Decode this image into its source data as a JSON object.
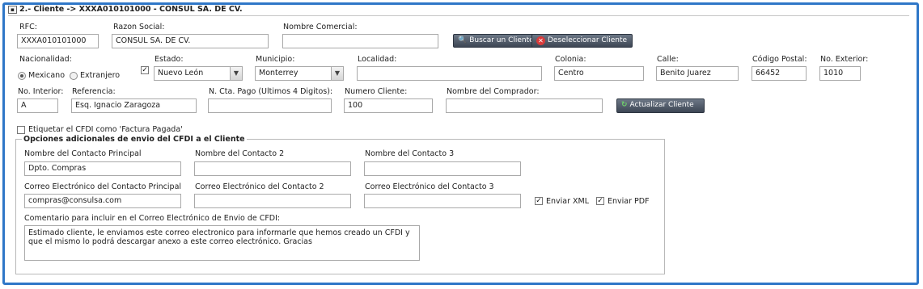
{
  "section": {
    "title": "2.- Cliente -> XXXA010101000 - CONSUL SA. DE CV.",
    "toggle_symbol": "▪"
  },
  "labels": {
    "rfc": "RFC:",
    "razon_social": "Razon Social:",
    "nombre_comercial": "Nombre Comercial:",
    "nacionalidad": "Nacionalidad:",
    "estado": "Estado:",
    "municipio": "Municipio:",
    "localidad": "Localidad:",
    "colonia": "Colonia:",
    "calle": "Calle:",
    "codigo_postal": "Código Postal:",
    "no_exterior": "No. Exterior:",
    "no_interior": "No. Interior:",
    "referencia": "Referencia:",
    "cta_pago": "N. Cta. Pago (Ultimos 4 Digitos):",
    "numero_cliente": "Numero Cliente:",
    "nombre_comprador": "Nombre del Comprador:"
  },
  "values": {
    "rfc": "XXXA010101000",
    "razon_social": "CONSUL SA. DE CV.",
    "nombre_comercial": "",
    "estado": "Nuevo León",
    "municipio": "Monterrey",
    "localidad": "",
    "colonia": "Centro",
    "calle": "Benito Juarez",
    "codigo_postal": "66452",
    "no_exterior": "1010",
    "no_interior": "A",
    "referencia": "Esq. Ignacio Zaragoza",
    "cta_pago": "",
    "numero_cliente": "100",
    "nombre_comprador": ""
  },
  "nacionalidad": {
    "options": [
      "Mexicano",
      "Extranjero"
    ],
    "selected": "Mexicano"
  },
  "buttons": {
    "buscar": "Buscar un Cliente",
    "deseleccionar": "Deseleccionar Cliente",
    "actualizar": "Actualizar Cliente"
  },
  "factura_pagada": {
    "label": "Etiquetar el CFDI como 'Factura Pagada'",
    "checked": false
  },
  "opciones": {
    "legend": "Opciones adicionales de envio del CFDI a el Cliente",
    "labels": {
      "contacto_principal": "Nombre del Contacto Principal",
      "contacto_2": "Nombre del Contacto 2",
      "contacto_3": "Nombre del Contacto 3",
      "correo_principal": "Correo Electrónico del Contacto Principal",
      "correo_2": "Correo Electrónico del Contacto 2",
      "correo_3": "Correo Electrónico del Contacto 3",
      "comentario": "Comentario para incluir en el Correo Electrónico de Envio de CFDI:"
    },
    "values": {
      "contacto_principal": "Dpto. Compras",
      "contacto_2": "",
      "contacto_3": "",
      "correo_principal": "compras@consulsa.com",
      "correo_2": "",
      "correo_3": "",
      "comentario": "Estimado cliente, le enviamos este correo electronico para informarle que hemos creado un CFDI y que el mismo lo podrá descargar anexo a este correo electrónico. Gracias"
    },
    "enviar_xml": {
      "label": "Enviar XML",
      "checked": true
    },
    "enviar_pdf": {
      "label": "Enviar PDF",
      "checked": true
    }
  },
  "glyphs": {
    "dropdown": "▼",
    "check": "✓",
    "binoculars": "🔍",
    "x": "✕",
    "refresh": "↻"
  }
}
